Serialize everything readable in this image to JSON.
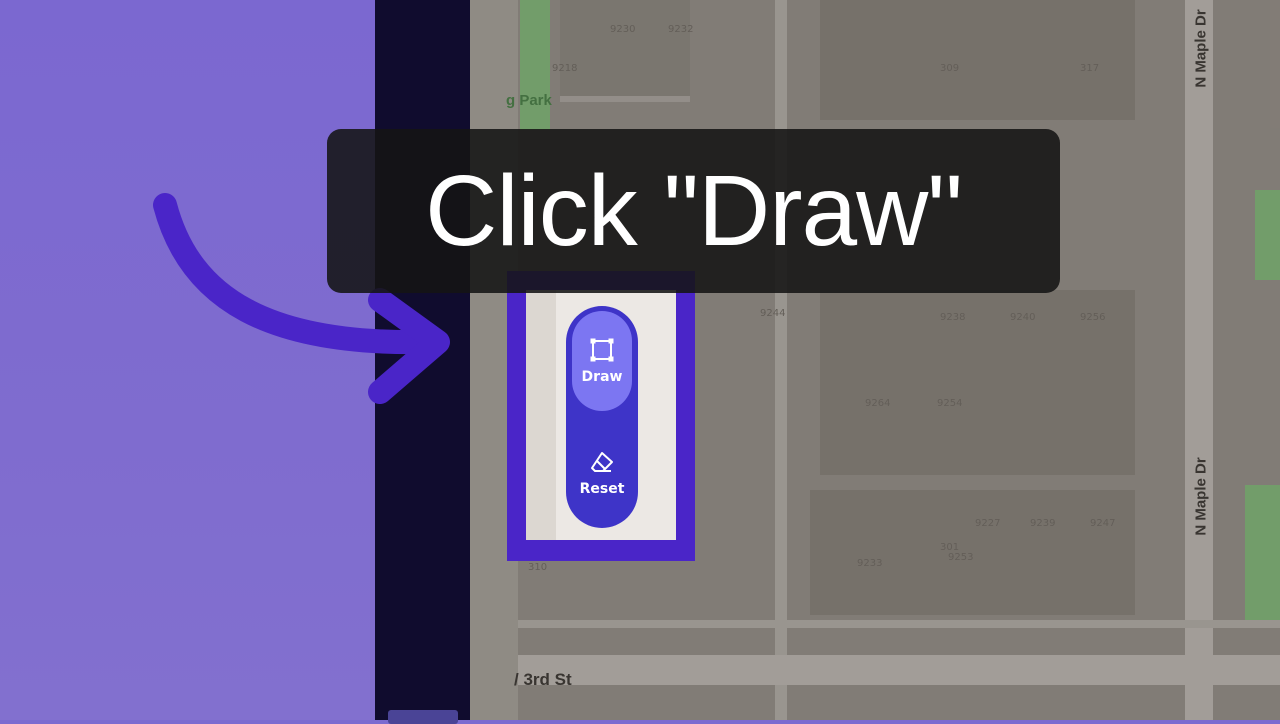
{
  "caption": {
    "text": "Click \"Draw\""
  },
  "toolbar": {
    "draw": {
      "label": "Draw",
      "icon": "draw-square-icon"
    },
    "reset": {
      "label": "Reset",
      "icon": "eraser-icon"
    }
  },
  "map": {
    "labels": {
      "park": "g Park",
      "street_maple_top": "N Maple Dr",
      "street_maple_mid": "N Maple Dr",
      "street_3rd": "/ 3rd St"
    },
    "addresses": [
      "9230",
      "9232",
      "9218",
      "309",
      "317",
      "9244",
      "9238",
      "9240",
      "9256",
      "9264",
      "9254",
      "9227",
      "9239",
      "9247",
      "9233",
      "9253",
      "301",
      "310"
    ]
  },
  "colors": {
    "accent": "#4a25c8",
    "button_active": "#7c76f2",
    "button_pill": "#3e34c8",
    "left_panel": "#7b68d0"
  }
}
